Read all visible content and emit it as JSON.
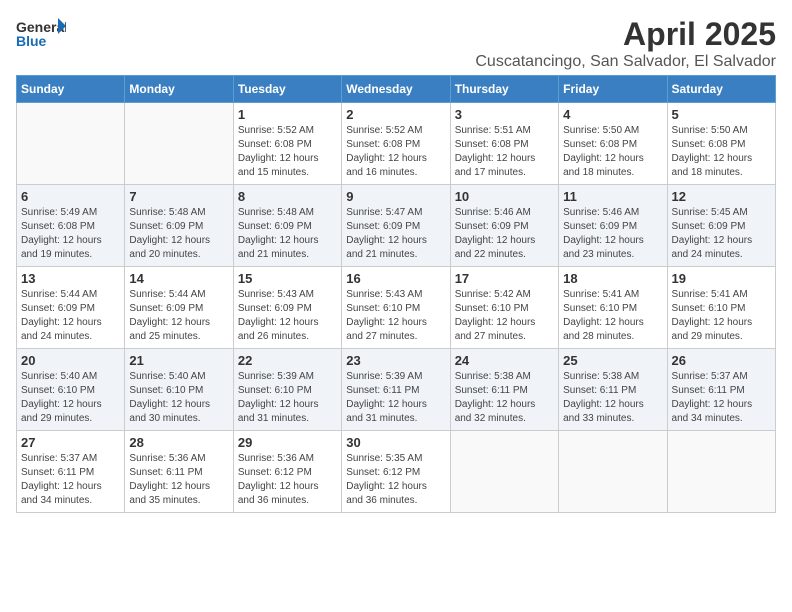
{
  "header": {
    "logo_line1": "General",
    "logo_line2": "Blue",
    "month_title": "April 2025",
    "subtitle": "Cuscatancingo, San Salvador, El Salvador"
  },
  "days_of_week": [
    "Sunday",
    "Monday",
    "Tuesday",
    "Wednesday",
    "Thursday",
    "Friday",
    "Saturday"
  ],
  "weeks": [
    {
      "shaded": false,
      "days": [
        {
          "num": "",
          "info": ""
        },
        {
          "num": "",
          "info": ""
        },
        {
          "num": "1",
          "info": "Sunrise: 5:52 AM\nSunset: 6:08 PM\nDaylight: 12 hours and 15 minutes."
        },
        {
          "num": "2",
          "info": "Sunrise: 5:52 AM\nSunset: 6:08 PM\nDaylight: 12 hours and 16 minutes."
        },
        {
          "num": "3",
          "info": "Sunrise: 5:51 AM\nSunset: 6:08 PM\nDaylight: 12 hours and 17 minutes."
        },
        {
          "num": "4",
          "info": "Sunrise: 5:50 AM\nSunset: 6:08 PM\nDaylight: 12 hours and 18 minutes."
        },
        {
          "num": "5",
          "info": "Sunrise: 5:50 AM\nSunset: 6:08 PM\nDaylight: 12 hours and 18 minutes."
        }
      ]
    },
    {
      "shaded": true,
      "days": [
        {
          "num": "6",
          "info": "Sunrise: 5:49 AM\nSunset: 6:08 PM\nDaylight: 12 hours and 19 minutes."
        },
        {
          "num": "7",
          "info": "Sunrise: 5:48 AM\nSunset: 6:09 PM\nDaylight: 12 hours and 20 minutes."
        },
        {
          "num": "8",
          "info": "Sunrise: 5:48 AM\nSunset: 6:09 PM\nDaylight: 12 hours and 21 minutes."
        },
        {
          "num": "9",
          "info": "Sunrise: 5:47 AM\nSunset: 6:09 PM\nDaylight: 12 hours and 21 minutes."
        },
        {
          "num": "10",
          "info": "Sunrise: 5:46 AM\nSunset: 6:09 PM\nDaylight: 12 hours and 22 minutes."
        },
        {
          "num": "11",
          "info": "Sunrise: 5:46 AM\nSunset: 6:09 PM\nDaylight: 12 hours and 23 minutes."
        },
        {
          "num": "12",
          "info": "Sunrise: 5:45 AM\nSunset: 6:09 PM\nDaylight: 12 hours and 24 minutes."
        }
      ]
    },
    {
      "shaded": false,
      "days": [
        {
          "num": "13",
          "info": "Sunrise: 5:44 AM\nSunset: 6:09 PM\nDaylight: 12 hours and 24 minutes."
        },
        {
          "num": "14",
          "info": "Sunrise: 5:44 AM\nSunset: 6:09 PM\nDaylight: 12 hours and 25 minutes."
        },
        {
          "num": "15",
          "info": "Sunrise: 5:43 AM\nSunset: 6:09 PM\nDaylight: 12 hours and 26 minutes."
        },
        {
          "num": "16",
          "info": "Sunrise: 5:43 AM\nSunset: 6:10 PM\nDaylight: 12 hours and 27 minutes."
        },
        {
          "num": "17",
          "info": "Sunrise: 5:42 AM\nSunset: 6:10 PM\nDaylight: 12 hours and 27 minutes."
        },
        {
          "num": "18",
          "info": "Sunrise: 5:41 AM\nSunset: 6:10 PM\nDaylight: 12 hours and 28 minutes."
        },
        {
          "num": "19",
          "info": "Sunrise: 5:41 AM\nSunset: 6:10 PM\nDaylight: 12 hours and 29 minutes."
        }
      ]
    },
    {
      "shaded": true,
      "days": [
        {
          "num": "20",
          "info": "Sunrise: 5:40 AM\nSunset: 6:10 PM\nDaylight: 12 hours and 29 minutes."
        },
        {
          "num": "21",
          "info": "Sunrise: 5:40 AM\nSunset: 6:10 PM\nDaylight: 12 hours and 30 minutes."
        },
        {
          "num": "22",
          "info": "Sunrise: 5:39 AM\nSunset: 6:10 PM\nDaylight: 12 hours and 31 minutes."
        },
        {
          "num": "23",
          "info": "Sunrise: 5:39 AM\nSunset: 6:11 PM\nDaylight: 12 hours and 31 minutes."
        },
        {
          "num": "24",
          "info": "Sunrise: 5:38 AM\nSunset: 6:11 PM\nDaylight: 12 hours and 32 minutes."
        },
        {
          "num": "25",
          "info": "Sunrise: 5:38 AM\nSunset: 6:11 PM\nDaylight: 12 hours and 33 minutes."
        },
        {
          "num": "26",
          "info": "Sunrise: 5:37 AM\nSunset: 6:11 PM\nDaylight: 12 hours and 34 minutes."
        }
      ]
    },
    {
      "shaded": false,
      "days": [
        {
          "num": "27",
          "info": "Sunrise: 5:37 AM\nSunset: 6:11 PM\nDaylight: 12 hours and 34 minutes."
        },
        {
          "num": "28",
          "info": "Sunrise: 5:36 AM\nSunset: 6:11 PM\nDaylight: 12 hours and 35 minutes."
        },
        {
          "num": "29",
          "info": "Sunrise: 5:36 AM\nSunset: 6:12 PM\nDaylight: 12 hours and 36 minutes."
        },
        {
          "num": "30",
          "info": "Sunrise: 5:35 AM\nSunset: 6:12 PM\nDaylight: 12 hours and 36 minutes."
        },
        {
          "num": "",
          "info": ""
        },
        {
          "num": "",
          "info": ""
        },
        {
          "num": "",
          "info": ""
        }
      ]
    }
  ]
}
